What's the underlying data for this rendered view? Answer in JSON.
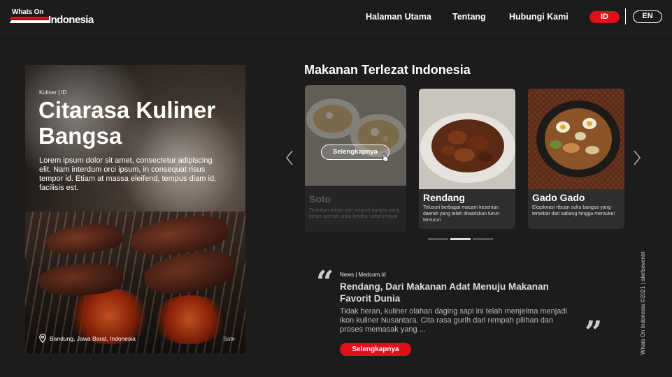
{
  "brand": {
    "logo_top": "Whats On",
    "logo_main": "Indonesia"
  },
  "nav": {
    "links": [
      "Halaman Utama",
      "Tentang",
      "Hubungi Kami"
    ],
    "lang_active": "ID",
    "lang_other": "EN"
  },
  "hero": {
    "category": "Kuliner | ID",
    "title": "Citarasa Kuliner Bangsa",
    "description": "Lorem ipsum dolor sit amet, consectetur adipiscing elit. Nam interdum orci ipsum, in consequat risus tempor id. Etiam at massa eleifend, tempus diam id, facilisis est.",
    "location": "Bandung, Jawa Barat, Indonesia",
    "tag": "Sate"
  },
  "section": {
    "title": "Makanan Terlezat Indonesia"
  },
  "cards": [
    {
      "name": "Soto",
      "description": "Temukan tradisi dari seluruh bangsa yang belum pernah anda ketahui sebelumnya!"
    },
    {
      "name": "Rendang",
      "description": "Telusuri berbagai macam kesenian daerah yang telah diwariskan turun temurun"
    },
    {
      "name": "Gado Gado",
      "description": "Eksplorasi ribuan suku bangsa yang tersebar dari sabang hingga merauke!"
    }
  ],
  "card_button": "Selengkapnya",
  "carousel": {
    "dot_count": 3,
    "active_dot": 1
  },
  "news": {
    "category": "News | Medcom.id",
    "title": "Rendang, Dari Makanan Adat Menuju Makanan Favorit Dunia",
    "body": "Tidak heran, kuliner olahan daging sapi ini telah menjelma menjadi ikon kuliner Nusantara. Cita rasa gurih dari rempah pilihan dan proses memasak yang ...",
    "button": "Selengkapnya"
  },
  "credit": "Whats On Indonesia ©2021 | aliefseventri",
  "colors": {
    "accent": "#e0101a",
    "background": "#1c1c1c"
  }
}
